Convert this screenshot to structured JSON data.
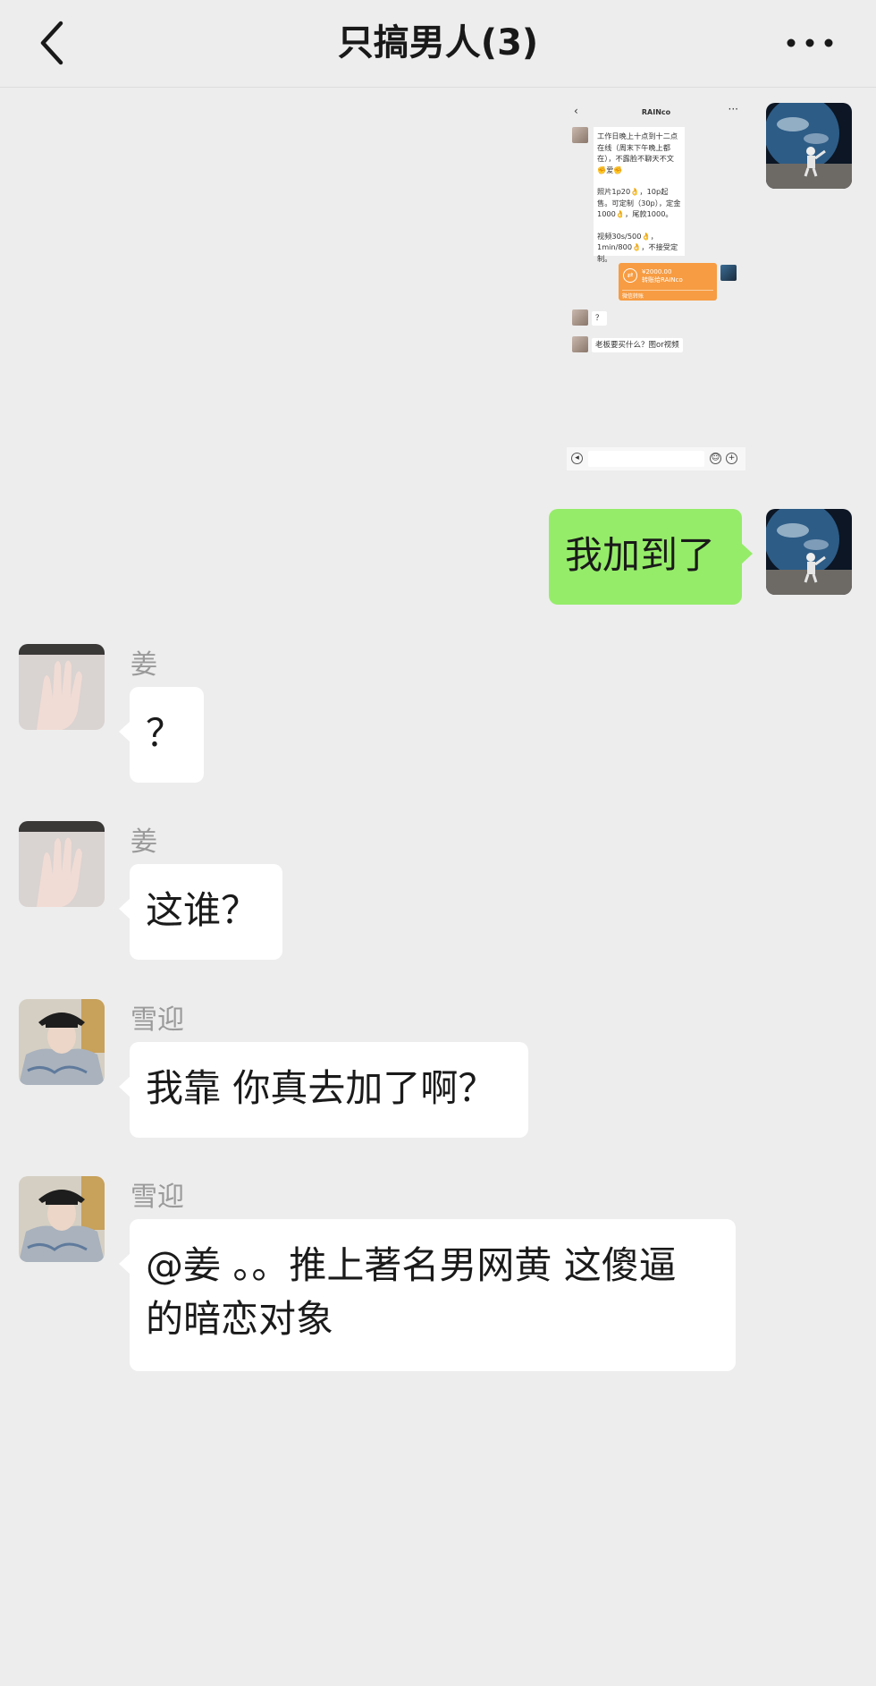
{
  "header": {
    "title": "只搞男人(3)",
    "back_icon": "chevron-left-icon",
    "more_icon": "more-dots-icon"
  },
  "embedded_screenshot": {
    "title": "RAINco",
    "card_lines": [
      "工作日晚上十点到十二点在线（周末下午晚上都在），不露脸不聊天不文✊爱✊",
      "照片1p20👌，10p起售。可定制（30p），定金1000👌，尾款1000。",
      "视频30s/500👌，1min/800👌，不接受定制。"
    ],
    "payment_amount": "¥2000.00",
    "payment_desc": "转账给RAINco",
    "payment_footer": "微信转账",
    "reply_1": "？",
    "reply_2": "老板要买什么？图or视频"
  },
  "messages": [
    {
      "sender": "",
      "side": "right",
      "text": "我加到了"
    },
    {
      "sender": "姜",
      "side": "left",
      "text": "？"
    },
    {
      "sender": "姜",
      "side": "left",
      "text": "这谁？"
    },
    {
      "sender": "雪迎",
      "side": "left",
      "text": "我靠 你真去加了啊？"
    },
    {
      "sender": "雪迎",
      "side": "left",
      "text_line1": "@姜 。。推上著名男网黄 这傻逼",
      "text_line2": "的暗恋对象"
    }
  ],
  "colors": {
    "background": "#ededed",
    "self_bubble": "#95ec69",
    "other_bubble": "#ffffff",
    "name_text": "#9a9a9a",
    "transfer_card": "#f79c42"
  }
}
